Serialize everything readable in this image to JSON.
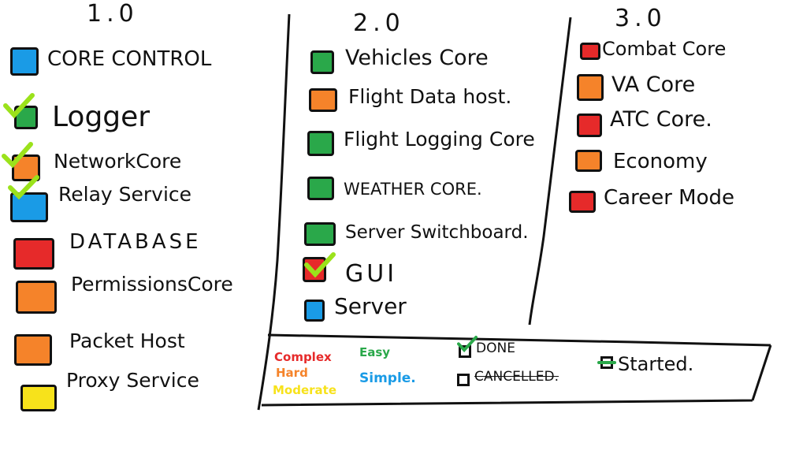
{
  "columns": [
    {
      "header": "1.0",
      "items": [
        {
          "label": "CORE CONTROL",
          "color": "#1a9be6",
          "status": "none"
        },
        {
          "label": "Logger",
          "color": "#2aa84a",
          "status": "done"
        },
        {
          "label": "NetworkCore",
          "color": "#f5832a",
          "status": "done"
        },
        {
          "label": "Relay Service",
          "color": "#1a9be6",
          "status": "done"
        },
        {
          "label": "DATABASE",
          "color": "#e62a2a",
          "status": "none"
        },
        {
          "label": "PermissionsCore",
          "color": "#f5832a",
          "status": "none"
        },
        {
          "label": "Packet Host",
          "color": "#f5832a",
          "status": "none"
        },
        {
          "label": "Proxy Service",
          "color": "#f7e21b",
          "status": "none"
        }
      ]
    },
    {
      "header": "2.0",
      "items": [
        {
          "label": "Vehicles Core",
          "color": "#2aa84a",
          "status": "none"
        },
        {
          "label": "Flight Data host.",
          "color": "#f5832a",
          "status": "none"
        },
        {
          "label": "Flight Logging Core",
          "color": "#2aa84a",
          "status": "none"
        },
        {
          "label": "WEATHER CORE.",
          "color": "#2aa84a",
          "status": "none"
        },
        {
          "label": "Server Switchboard.",
          "color": "#2aa84a",
          "status": "none"
        },
        {
          "label": "GUI",
          "color": "#e62a2a",
          "status": "done"
        },
        {
          "label": "Server",
          "color": "#1a9be6",
          "status": "none"
        }
      ]
    },
    {
      "header": "3.0",
      "items": [
        {
          "label": "Combat Core",
          "color": "#e62a2a",
          "status": "none"
        },
        {
          "label": "VA Core",
          "color": "#f5832a",
          "status": "none"
        },
        {
          "label": "ATC Core.",
          "color": "#e62a2a",
          "status": "none"
        },
        {
          "label": "Economy",
          "color": "#f5832a",
          "status": "none"
        },
        {
          "label": "Career Mode",
          "color": "#e62a2a",
          "status": "none"
        }
      ]
    }
  ],
  "legend": {
    "difficulty": [
      {
        "label": "Complex",
        "color": "#e62a2a"
      },
      {
        "label": "Hard",
        "color": "#f5832a"
      },
      {
        "label": "Moderate",
        "color": "#f7e21b"
      },
      {
        "label": "Easy",
        "color": "#2aa84a"
      },
      {
        "label": "Simple.",
        "color": "#1a9be6"
      }
    ],
    "status": [
      {
        "label": "DONE",
        "mark": "check"
      },
      {
        "label": "CANCELLED.",
        "mark": "strike"
      },
      {
        "label": "Started.",
        "mark": "dash"
      }
    ]
  },
  "check_color": "#9be21b"
}
